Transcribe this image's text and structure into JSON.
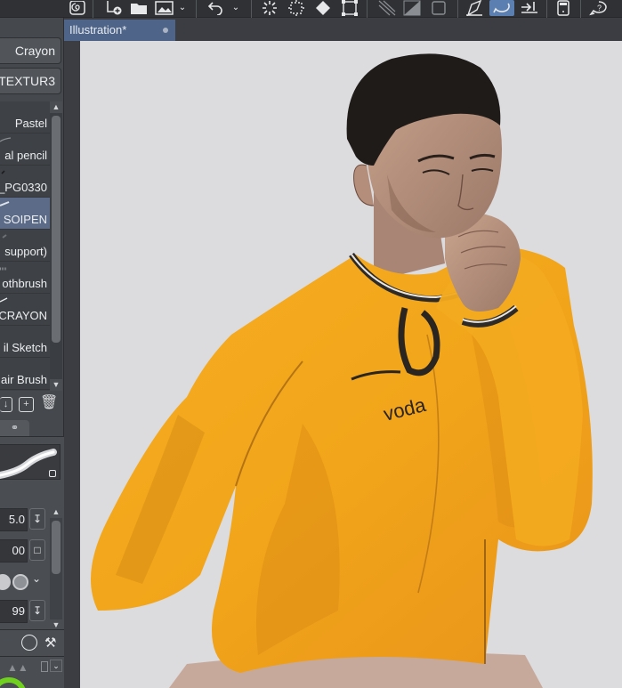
{
  "document": {
    "tab_title": "Illustration*"
  },
  "toolbar": {
    "icons": [
      "spiral-icon",
      "add-page-icon",
      "folder-icon",
      "image-icon",
      "chevron-down-icon",
      "undo-icon",
      "chevron-down-icon",
      "burst-icon",
      "dashed-burst-icon",
      "fill-icon",
      "transform-icon",
      "perspective-icon",
      "gradient-icon",
      "square-icon",
      "ruler-pen-icon",
      "lasso-icon",
      "export-icon",
      "tablet-icon",
      "hint-icon"
    ]
  },
  "left_panel": {
    "sub_tabs": [
      "Crayon",
      "TEXTUR3"
    ],
    "brushes": [
      {
        "label": "Pastel"
      },
      {
        "label": "al pencil"
      },
      {
        "label": "_PG0330"
      },
      {
        "label": "SOIPEN",
        "selected": true
      },
      {
        "label": "support)"
      },
      {
        "label": "othbrush"
      },
      {
        "label": "CRAYON"
      },
      {
        "label": "il Sketch"
      },
      {
        "label": "air Brush"
      }
    ],
    "properties": {
      "brush_size": "5.0",
      "opacity": "00",
      "density": "99"
    }
  },
  "colors": {
    "panel_bg": "#45484d",
    "selection": "#5b6b88",
    "tab_active": "#4e6488",
    "canvas_bg": "#dcdbde",
    "shirt": "#f2a81d"
  }
}
